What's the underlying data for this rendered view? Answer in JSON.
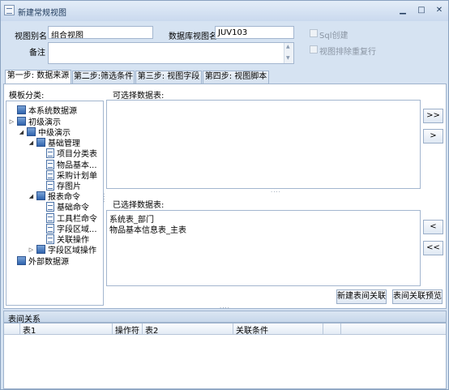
{
  "window": {
    "title": "新建常规视图",
    "minimize": "▁",
    "maximize": "□",
    "close": "✕",
    "icon": "app-form-icon"
  },
  "form": {
    "alias_label": "视图别名",
    "alias_value": "组合视图",
    "dbview_label": "数据库视图名",
    "dbview_value": "JUV103",
    "note_label": "备注",
    "note_value": "",
    "sql_create_label": "Sql创建",
    "dedupe_label": "视图排除重复行"
  },
  "tabs": [
    {
      "label": "第一步: 数据来源"
    },
    {
      "label": "第二步:筛选条件"
    },
    {
      "label": "第三步: 视图字段"
    },
    {
      "label": "第四步: 视图脚本"
    }
  ],
  "tree": {
    "label": "模板分类:",
    "nodes": [
      {
        "label": "本系统数据源",
        "expander": "",
        "icon": "folder-icon"
      },
      {
        "label": "初级演示",
        "expander": "▷",
        "icon": "folder-icon"
      },
      {
        "label": "中级演示",
        "expander": "◢",
        "icon": "folder-icon"
      },
      {
        "label": "基础管理",
        "expander": "◢",
        "icon": "folder-icon"
      },
      {
        "label": "项目分类表",
        "expander": "",
        "icon": "table-icon"
      },
      {
        "label": "物品基本...",
        "expander": "",
        "icon": "table-icon"
      },
      {
        "label": "采购计划单",
        "expander": "",
        "icon": "table-icon"
      },
      {
        "label": "存图片",
        "expander": "",
        "icon": "table-icon"
      },
      {
        "label": "报表命令",
        "expander": "◢",
        "icon": "folder-icon"
      },
      {
        "label": "基础命令",
        "expander": "",
        "icon": "table-icon"
      },
      {
        "label": "工具栏命令",
        "expander": "",
        "icon": "table-icon"
      },
      {
        "label": "字段区域...",
        "expander": "",
        "icon": "table-icon"
      },
      {
        "label": "关联操作",
        "expander": "",
        "icon": "table-icon"
      },
      {
        "label": "字段区域操作",
        "expander": "▷",
        "icon": "folder-icon"
      },
      {
        "label": "外部数据源",
        "expander": "",
        "icon": "folder-icon"
      }
    ]
  },
  "available": {
    "label": "可选择数据表:",
    "items": []
  },
  "selected": {
    "label": "已选择数据表:",
    "items": [
      "系统表_部门",
      "物品基本信息表_主表"
    ]
  },
  "buttons": {
    "add_all": ">>",
    "add_one": ">",
    "remove_one": "<",
    "remove_all": "<<",
    "new_relation": "新建表间关联",
    "preview_relation": "表间关联预览"
  },
  "splitter": "....",
  "relations": {
    "title": "表间关系",
    "columns": [
      "表1",
      "操作符",
      "表2",
      "关联条件",
      "",
      ""
    ]
  }
}
